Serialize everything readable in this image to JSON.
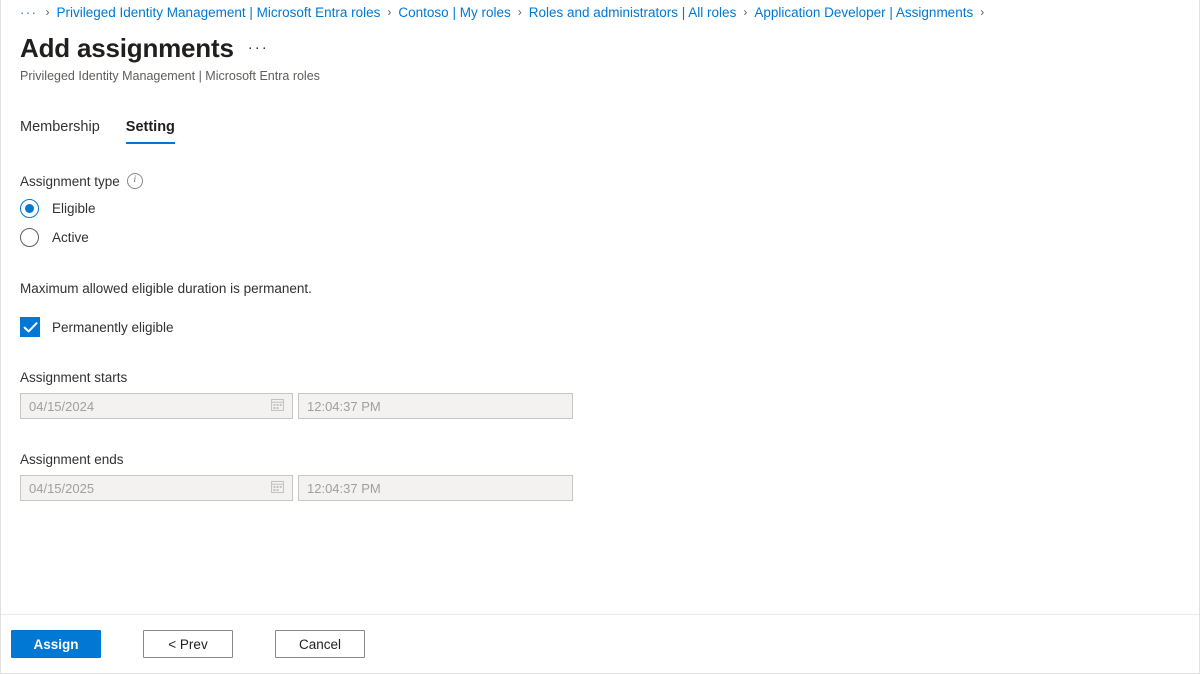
{
  "breadcrumb": {
    "ellipsis": "···",
    "separator": "›",
    "items": [
      {
        "label": "Privileged Identity Management | Microsoft Entra roles"
      },
      {
        "label": "Contoso | My roles"
      },
      {
        "label": "Roles and administrators | All roles"
      },
      {
        "label": "Application Developer | Assignments"
      }
    ],
    "trailing_separator": "›"
  },
  "header": {
    "title": "Add assignments",
    "more_label": "···",
    "subtitle": "Privileged Identity Management | Microsoft Entra roles"
  },
  "tabs": [
    {
      "label": "Membership",
      "active": false
    },
    {
      "label": "Setting",
      "active": true
    }
  ],
  "form": {
    "assignment_type": {
      "label": "Assignment type",
      "info_glyph": "i",
      "options": [
        {
          "label": "Eligible",
          "selected": true
        },
        {
          "label": "Active",
          "selected": false
        }
      ]
    },
    "duration_note": "Maximum allowed eligible duration is permanent.",
    "permanently_eligible": {
      "label": "Permanently eligible",
      "checked": true
    },
    "assignment_starts": {
      "label": "Assignment starts",
      "date_value": "04/15/2024",
      "time_value": "12:04:37 PM",
      "date_icon": "calendar-icon"
    },
    "assignment_ends": {
      "label": "Assignment ends",
      "date_value": "04/15/2025",
      "time_value": "12:04:37 PM",
      "date_icon": "calendar-icon"
    }
  },
  "footer": {
    "assign_label": "Assign",
    "prev_label": "< Prev",
    "cancel_label": "Cancel"
  },
  "colors": {
    "accent": "#0078d4",
    "link": "#0078d4",
    "text": "#323130",
    "muted": "#605e5c",
    "disabled_bg": "#f3f2f1",
    "disabled_border": "#c8c6c4",
    "disabled_text": "#a19f9d",
    "border": "#e1e1e1"
  }
}
